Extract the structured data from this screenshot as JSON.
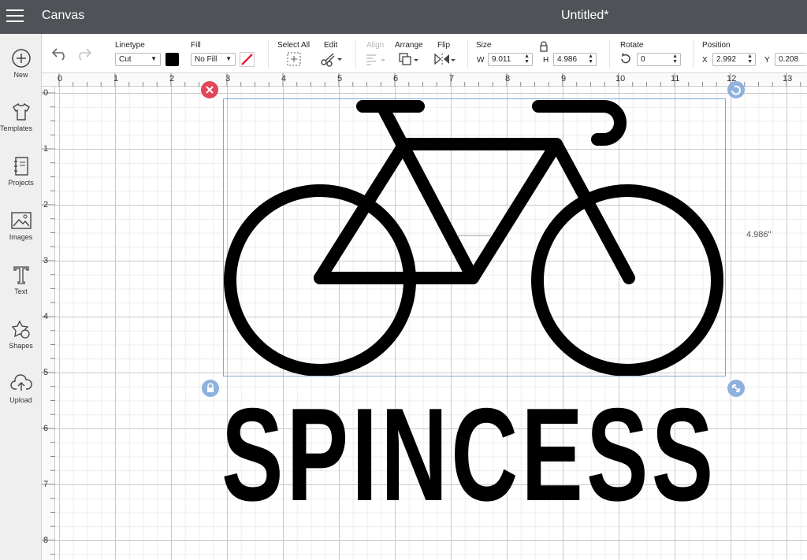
{
  "header": {
    "app_title": "Canvas",
    "doc_title": "Untitled*"
  },
  "toolbar": {
    "linetype": {
      "label": "Linetype",
      "value": "Cut"
    },
    "fill": {
      "label": "Fill",
      "value": "No Fill"
    },
    "select_all_label": "Select All",
    "edit_label": "Edit",
    "align_label": "Align",
    "arrange_label": "Arrange",
    "flip_label": "Flip",
    "size": {
      "label": "Size",
      "w_label": "W",
      "w_value": "9.011",
      "h_label": "H",
      "h_value": "4.986"
    },
    "rotate": {
      "label": "Rotate",
      "value": "0"
    },
    "position": {
      "label": "Position",
      "x_label": "X",
      "x_value": "2.992",
      "y_label": "Y",
      "y_value": "0.208"
    },
    "colors": {
      "linetype_swatch": "#000000",
      "no_fill_slash": "#e0212f"
    }
  },
  "sidebar": {
    "items": [
      {
        "label": "New",
        "icon": "plus-circle-icon"
      },
      {
        "label": "Templates",
        "icon": "tshirt-icon"
      },
      {
        "label": "Projects",
        "icon": "notebook-icon"
      },
      {
        "label": "Images",
        "icon": "image-icon"
      },
      {
        "label": "Text",
        "icon": "text-t-icon"
      },
      {
        "label": "Shapes",
        "icon": "shapes-icon"
      },
      {
        "label": "Upload",
        "icon": "cloud-upload-icon"
      }
    ]
  },
  "canvas": {
    "ruler_top": [
      "0",
      "1",
      "2",
      "3",
      "4",
      "5",
      "6",
      "7",
      "8",
      "9",
      "10",
      "11",
      "12",
      "13"
    ],
    "ruler_left": [
      "0",
      "1",
      "2",
      "3",
      "4",
      "5",
      "6",
      "7",
      "8"
    ],
    "height_label": "4.986\"",
    "design_text": "SPINCESS",
    "colors": {
      "delete_handle": "#e2465a",
      "selection_handle": "#8fb1dd",
      "selection_border": "#7fa7d6"
    }
  }
}
